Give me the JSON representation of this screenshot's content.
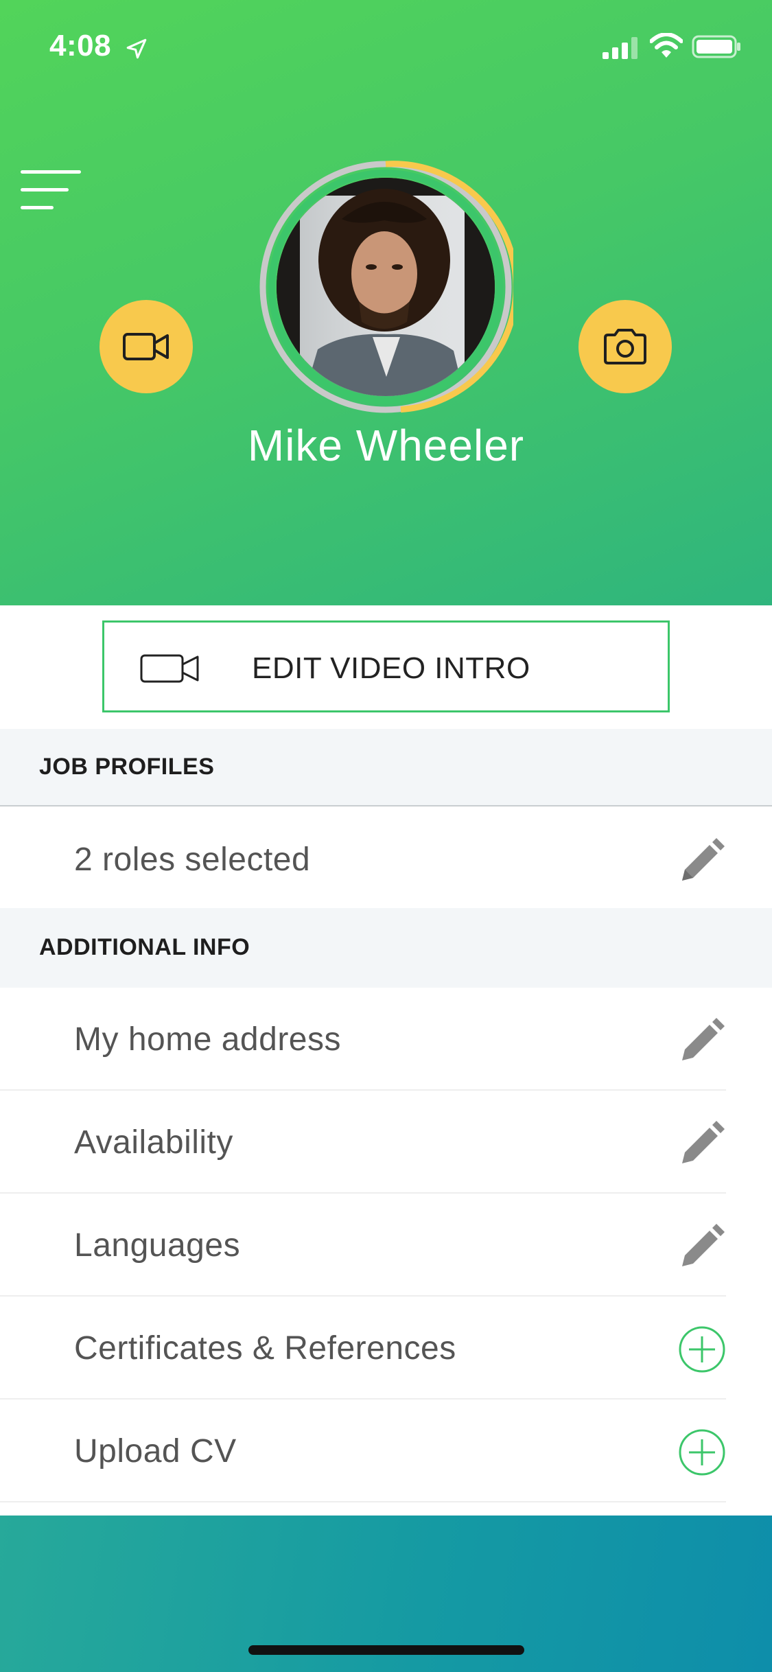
{
  "status_bar": {
    "time": "4:08"
  },
  "profile": {
    "name": "Mike Wheeler"
  },
  "edit_video": {
    "label": "EDIT VIDEO INTRO"
  },
  "sections": {
    "job_profiles": {
      "title": "JOB PROFILES",
      "summary": "2 roles selected"
    },
    "additional_info": {
      "title": "ADDITIONAL INFO",
      "items": [
        {
          "label": "My home address",
          "icon": "pencil-icon"
        },
        {
          "label": "Availability",
          "icon": "pencil-icon"
        },
        {
          "label": "Languages",
          "icon": "pencil-icon"
        },
        {
          "label": "Certificates & References",
          "icon": "plus-circle-icon"
        },
        {
          "label": "Upload CV",
          "icon": "plus-circle-icon"
        }
      ]
    }
  },
  "colors": {
    "header_start": "#52d45a",
    "header_end": "#2fb57d",
    "accent_yellow": "#f8c94d",
    "accent_green": "#3cc66a",
    "bottom_band": "#159aa3"
  }
}
